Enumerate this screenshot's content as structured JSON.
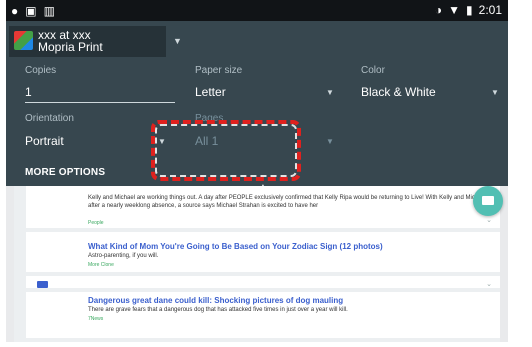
{
  "status_bar": {
    "time": "2:01",
    "left_icons": [
      "notification-icon",
      "image-icon",
      "device-icon"
    ],
    "right_icons": [
      "sync-icon",
      "wifi-icon",
      "battery-icon"
    ]
  },
  "printer": {
    "line1": "xxx at xxx",
    "line2": "Mopria Print"
  },
  "options": {
    "copies": {
      "label": "Copies",
      "value": "1"
    },
    "paper_size": {
      "label": "Paper size",
      "value": "Letter"
    },
    "color": {
      "label": "Color",
      "value": "Black & White"
    },
    "orientation": {
      "label": "Orientation",
      "value": "Portrait"
    },
    "pages": {
      "label": "Pages",
      "value": "All 1"
    },
    "more_options": "MORE OPTIONS"
  },
  "articles": [
    {
      "headline": "Kelly and Michael are working things out. A day after PEOPLE exclusively confirmed that Kelly Ripa would be returning to Live! With Kelly and Michael! after a nearly weeklong absence, a source says Michael Strahan is excited to have her",
      "source": "People"
    },
    {
      "headline": "What Kind of Mom You're Going to Be Based on Your Zodiac Sign (12 photos)",
      "description": "Astro-parenting, if you will.",
      "source": "More Clone"
    },
    {
      "headline": "Dangerous great dane could kill: Shocking pictures of dog mauling",
      "description": "There are grave fears that a dangerous dog that has attacked five times in just over a year will kill.",
      "source": "7News"
    }
  ],
  "colors": {
    "panel": "#37474f",
    "accent_fab": "#52bfb3",
    "highlight": "#e0211e",
    "link": "#3a5fcd"
  }
}
